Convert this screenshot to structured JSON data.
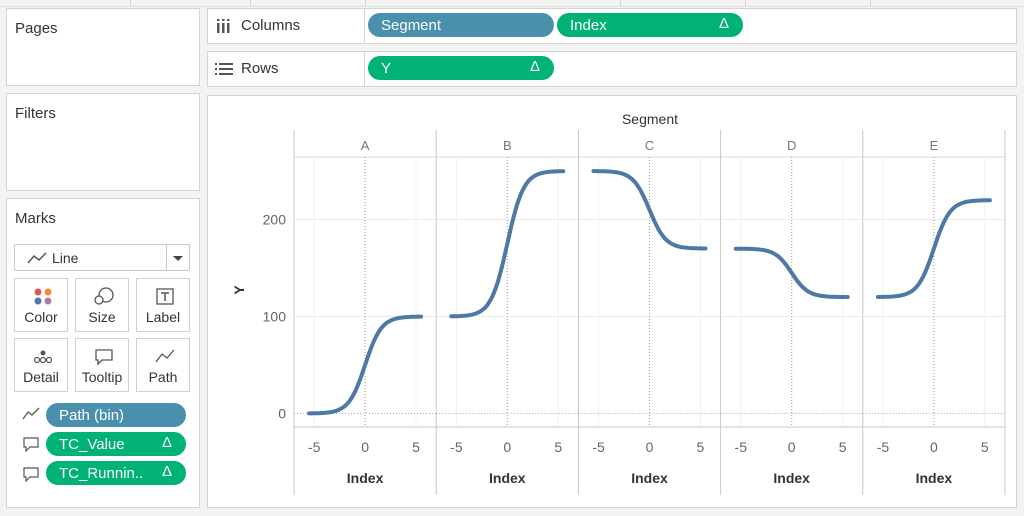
{
  "panels": {
    "pages_title": "Pages",
    "filters_title": "Filters",
    "marks_title": "Marks"
  },
  "marks": {
    "type_label": "Line",
    "buttons": {
      "color": "Color",
      "size": "Size",
      "label": "Label",
      "detail": "Detail",
      "tooltip": "Tooltip",
      "path": "Path"
    },
    "fields": [
      {
        "name": "Path (bin)",
        "icon": "path-icon",
        "pill_color": "#4a90ad",
        "delta": ""
      },
      {
        "name": "TC_Value",
        "icon": "tooltip-icon",
        "pill_color": "#00b277",
        "delta": "Δ"
      },
      {
        "name": "TC_Runnin..",
        "icon": "tooltip-icon",
        "pill_color": "#00b277",
        "delta": "Δ"
      }
    ]
  },
  "shelves": {
    "columns_label": "Columns",
    "rows_label": "Rows",
    "columns_pills": [
      {
        "name": "Segment",
        "color": "#4a90ad",
        "delta": ""
      },
      {
        "name": "Index",
        "color": "#00b277",
        "delta": "Δ"
      }
    ],
    "rows_pills": [
      {
        "name": "Y",
        "color": "#00b277",
        "delta": "Δ"
      }
    ]
  },
  "chart_data": {
    "type": "line",
    "title": "",
    "facet_label": "Segment",
    "xlabel": "Index",
    "ylabel": "Y",
    "xlim": [
      -6,
      6
    ],
    "ylim": [
      -12,
      262
    ],
    "x_ticks": [
      -5,
      0,
      5
    ],
    "y_ticks": [
      0,
      100,
      200
    ],
    "line_color": "#4e79a7",
    "grid": true,
    "panels": [
      {
        "name": "A",
        "start": 0,
        "end": 100
      },
      {
        "name": "B",
        "start": 100,
        "end": 250
      },
      {
        "name": "C",
        "start": 250,
        "end": 170
      },
      {
        "name": "D",
        "start": 170,
        "end": 120
      },
      {
        "name": "E",
        "start": 120,
        "end": 220
      }
    ],
    "x_values": [
      -5.5,
      -4.5,
      -3.5,
      -2.5,
      -1.5,
      -0.5,
      0.5,
      1.5,
      2.5,
      3.5,
      4.5,
      5.5
    ]
  }
}
